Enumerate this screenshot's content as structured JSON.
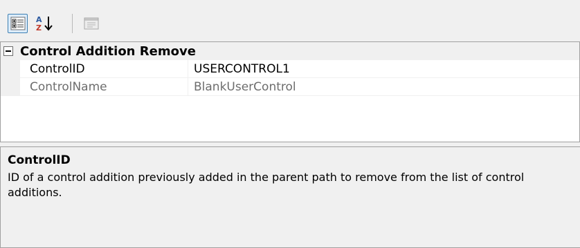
{
  "toolbar": {
    "buttons": [
      {
        "name": "categorized-view-button",
        "icon": "categorized-list-icon",
        "pressed": true
      },
      {
        "name": "alphabetical-sort-button",
        "icon": "sort-az-icon",
        "pressed": false
      },
      {
        "name": "property-pages-button",
        "icon": "property-pages-icon",
        "enabled": false
      }
    ]
  },
  "grid": {
    "category": {
      "label": "Control Addition Remove",
      "expanded": true
    },
    "properties": [
      {
        "name": "ControlID",
        "value": "USERCONTROL1",
        "readonly": false
      },
      {
        "name": "ControlName",
        "value": "BlankUserControl",
        "readonly": true
      }
    ]
  },
  "help": {
    "title": "ControlID",
    "description": "ID of a control addition previously added in the parent path to remove from the list of control additions."
  },
  "colors": {
    "accent_border": "#3c7fb1",
    "accent_fill": "#dcecfc",
    "panel_bg": "#f0f0f0",
    "readonly_text": "#6d6d6d"
  }
}
